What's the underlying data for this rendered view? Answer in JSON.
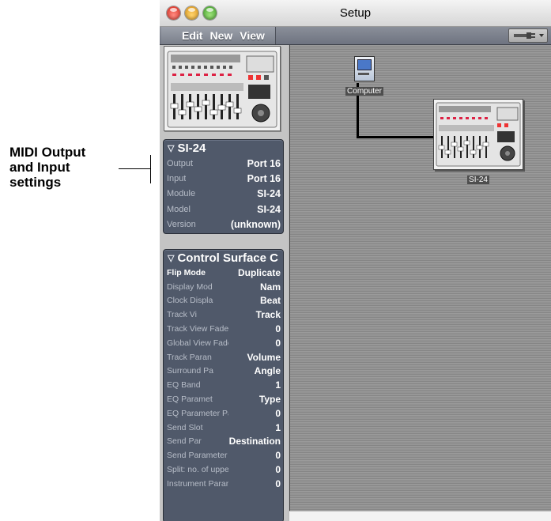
{
  "annotation": {
    "text": "MIDI Output and Input settings",
    "lines": [
      "MIDI Output",
      "and Input",
      "settings"
    ]
  },
  "window": {
    "title": "Setup",
    "menus": [
      "Edit",
      "New",
      "View"
    ]
  },
  "device_panel": {
    "title": "SI-24",
    "rows": [
      {
        "label": "Output",
        "value": "Port 16"
      },
      {
        "label": "Input",
        "value": "Port 16"
      },
      {
        "label": "Module",
        "value": "SI-24"
      },
      {
        "label": "Model",
        "value": "SI-24"
      },
      {
        "label": "Version",
        "value": "(unknown)"
      }
    ]
  },
  "control_panel": {
    "title": "Control Surface C",
    "rows": [
      {
        "label": "Flip Mode",
        "value": "Duplicate"
      },
      {
        "label": "Display Mod",
        "value": "Nam"
      },
      {
        "label": "Clock Displa",
        "value": "Beat"
      },
      {
        "label": "Track Vi",
        "value": "Track"
      },
      {
        "label": "Track View Fader Ba",
        "value": "0"
      },
      {
        "label": "Global View Fader B",
        "value": "0"
      },
      {
        "label": "Track Paran",
        "value": "Volume"
      },
      {
        "label": "Surround Pa",
        "value": "Angle"
      },
      {
        "label": "EQ Band",
        "value": "1"
      },
      {
        "label": "EQ Paramet",
        "value": "Type"
      },
      {
        "label": "EQ Parameter Page",
        "value": "0"
      },
      {
        "label": "Send Slot",
        "value": "1"
      },
      {
        "label": "Send Par",
        "value": "Destination"
      },
      {
        "label": "Send Parameter Page",
        "value": "0"
      },
      {
        "label": "Split: no. of upper p",
        "value": "0"
      },
      {
        "label": "Instrument Paramet",
        "value": "0"
      }
    ]
  },
  "canvas": {
    "nodes": [
      {
        "label": "Computer",
        "icon": "computer-icon"
      },
      {
        "label": "SI-24",
        "icon": "mixer-device-icon"
      }
    ]
  },
  "colors": {
    "panel_bg": "#50596a",
    "menubar_bg": "#7a7f8a",
    "canvas_bg": "#8e8e8e"
  }
}
